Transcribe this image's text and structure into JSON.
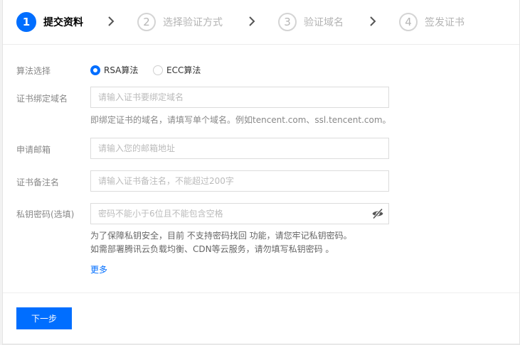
{
  "steps": [
    {
      "num": "1",
      "label": "提交资料",
      "active": true
    },
    {
      "num": "2",
      "label": "选择验证方式",
      "active": false
    },
    {
      "num": "3",
      "label": "验证域名",
      "active": false
    },
    {
      "num": "4",
      "label": "签发证书",
      "active": false
    }
  ],
  "colors": {
    "accent": "#006eff"
  },
  "form": {
    "algorithm": {
      "label": "算法选择",
      "options": [
        {
          "label": "RSA算法",
          "selected": true
        },
        {
          "label": "ECC算法",
          "selected": false
        }
      ]
    },
    "domain": {
      "label": "证书绑定域名",
      "placeholder": "请输入证书要绑定域名",
      "hint": "即绑定证书的域名，请填写单个域名。例如tencent.com、ssl.tencent.com。"
    },
    "email": {
      "label": "申请邮箱",
      "placeholder": "请输入您的邮箱地址"
    },
    "remark": {
      "label": "证书备注名",
      "placeholder": "请输入证书备注名，不能超过200字"
    },
    "private_key_password": {
      "label": "私钥密码(选填)",
      "placeholder": "密码不能小于6位且不能包含空格",
      "icon": "eye-off-icon",
      "hint_line1": "为了保障私钥安全，目前 不支持密码找回 功能，请您牢记私钥密码。",
      "hint_line2": "如需部署腾讯云负载均衡、CDN等云服务，请勿填写私钥密码 。"
    },
    "more_link": "更多"
  },
  "actions": {
    "next_label": "下一步"
  }
}
